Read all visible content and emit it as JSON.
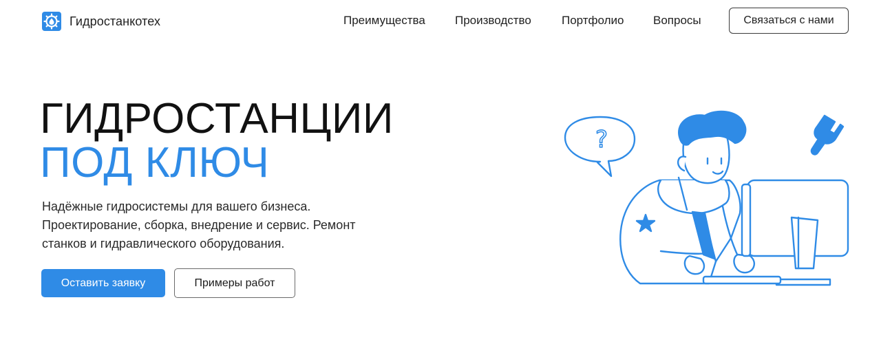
{
  "header": {
    "brand": "Гидростанкотех",
    "logo_icon": "water-drop-gear-icon",
    "nav": [
      {
        "label": "Преимущества"
      },
      {
        "label": "Производство"
      },
      {
        "label": "Портфолио"
      },
      {
        "label": "Вопросы"
      }
    ],
    "contact_label": "Связаться с нами"
  },
  "hero": {
    "title_line1": "ГИДРОСТАНЦИИ",
    "title_line2": "ПОД КЛЮЧ",
    "description": "Надёжные гидросистемы для вашего бизнеса. Проектирование, сборка, внедрение и сервис. Ремонт станков и гидравлического оборудования.",
    "primary_button": "Оставить заявку",
    "secondary_button": "Примеры работ"
  },
  "illustration": {
    "question_mark": "?",
    "icons": [
      "question-bubble-icon",
      "wrench-icon",
      "star-icon",
      "monitor-icon",
      "keyboard-icon"
    ]
  },
  "colors": {
    "accent": "#2f8be6",
    "text": "#1a1a1a",
    "background": "#ffffff"
  }
}
